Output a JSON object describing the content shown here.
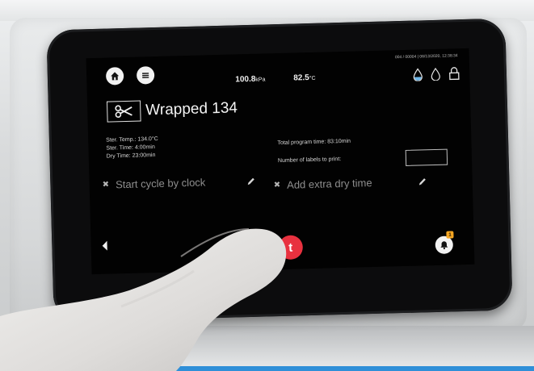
{
  "header": {
    "pressure_value": "100.8",
    "pressure_unit": "kPa",
    "temperature_value": "82.5",
    "temperature_unit": "°C",
    "status_line": "004 / 00004  |  06/13/2020, 12:38:34"
  },
  "program": {
    "title": "Wrapped 134",
    "ster_temp": "Ster. Temp.: 134.0°C",
    "ster_time": "Ster. Time: 4:00min",
    "dry_time": "Dry Time: 23:00min",
    "total_program_time": "Total program time: 83:10min",
    "labels_to_print": "Number of labels to print:"
  },
  "options": {
    "start_cycle_by_clock": "Start cycle by clock",
    "add_extra_dry_time": "Add extra dry time",
    "option_mark": "✖"
  },
  "controls": {
    "start_glyph": "t",
    "alarm_count": "1"
  },
  "icons": {
    "home": "home-icon",
    "menu": "menu-icon",
    "water_full": "water-drop-filled-icon",
    "water_empty": "water-drop-outline-icon",
    "lock": "padlock-icon",
    "program": "scissors-icon",
    "edit": "pencil-icon",
    "back": "back-arrow-icon",
    "alarm": "bell-icon"
  },
  "colors": {
    "screen_bg": "#020202",
    "start_button": "#e8313f",
    "water_blue": "#6fb7e8",
    "alarm_badge": "#f5a623"
  }
}
